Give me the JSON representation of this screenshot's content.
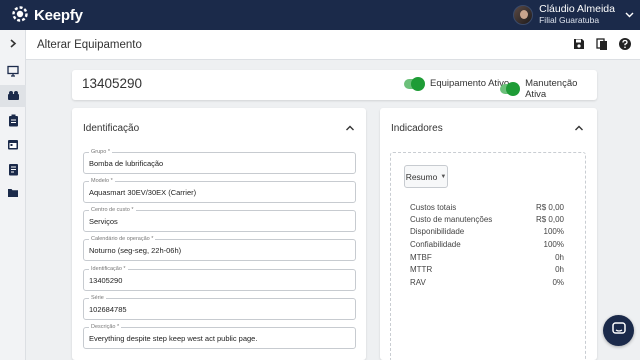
{
  "app": {
    "brand": "Keepfy",
    "user_name": "Cláudio Almeida",
    "user_branch": "Filial Guaratuba"
  },
  "header": {
    "title": "Alterar Equipamento",
    "actions": [
      "save-icon",
      "copy-icon",
      "help-icon"
    ]
  },
  "sidebar": {
    "items": [
      "expand-icon",
      "monitor-icon",
      "equipment-icon",
      "clipboard-icon",
      "calendar-icon",
      "report-icon",
      "folder-icon"
    ],
    "active": "equipment-icon"
  },
  "equipment": {
    "id": "13405290",
    "toggle_active_label": "Equipamento Ativo",
    "toggle_active_on": true,
    "toggle_maintenance_label": "Manutenção Ativa",
    "toggle_maintenance_on": true
  },
  "identification": {
    "title": "Identificação",
    "fields": [
      {
        "label": "Grupo *",
        "value": "Bomba de lubrificação"
      },
      {
        "label": "Modelo *",
        "value": "Aquasmart 30EV/30EX (Carrier)"
      },
      {
        "label": "Centro de custo *",
        "value": "Serviços"
      },
      {
        "label": "Calendário de operação *",
        "value": "Noturno (seg-seg, 22h-06h)"
      },
      {
        "label": "Identificação *",
        "value": "13405290"
      },
      {
        "label": "Série",
        "value": "102684785"
      },
      {
        "label": "Descrição *",
        "value": "Everything despite step keep west act public page."
      }
    ]
  },
  "indicators": {
    "title": "Indicadores",
    "dropdown_label": "Resumo",
    "rows": [
      {
        "label": "Custos totais",
        "value": "R$ 0,00"
      },
      {
        "label": "Custo de manutenções",
        "value": "R$ 0,00"
      },
      {
        "label": "Disponibilidade",
        "value": "100%"
      },
      {
        "label": "Confiabilidade",
        "value": "100%"
      },
      {
        "label": "MTBF",
        "value": "0h"
      },
      {
        "label": "MTTR",
        "value": "0h"
      },
      {
        "label": "RAV",
        "value": "0%"
      }
    ]
  },
  "colors": {
    "topbar": "#1b2a4a",
    "toggle_on": "#1e9c36",
    "toggle_track": "#6cc07a"
  }
}
